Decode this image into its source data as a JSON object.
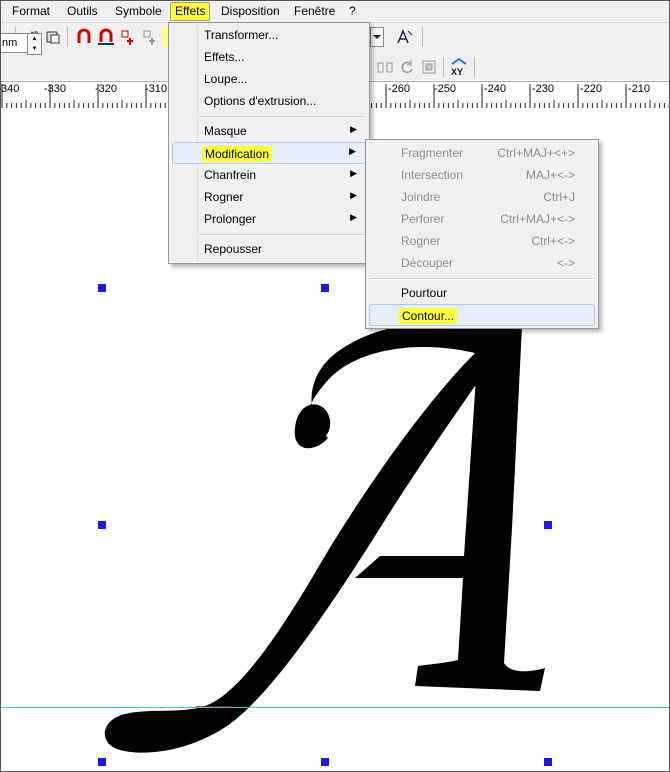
{
  "menubar": {
    "items": [
      {
        "label": "Format"
      },
      {
        "label": "Outils"
      },
      {
        "label": "Symbole"
      },
      {
        "label": "Effets"
      },
      {
        "label": "Disposition"
      },
      {
        "label": "Fenêtre"
      },
      {
        "label": "?"
      }
    ]
  },
  "toolbar": {
    "unit_value": "nm"
  },
  "ruler": {
    "labels": [
      "340",
      "-330",
      "-320",
      "-310",
      "-260",
      "-250",
      "-240",
      "-230",
      "-220",
      "-210"
    ]
  },
  "effets_menu": {
    "items": [
      {
        "label": "Transformer..."
      },
      {
        "label": "Effets..."
      },
      {
        "label": "Loupe..."
      },
      {
        "label": "Options d'extrusion..."
      },
      {
        "label": "Masque"
      },
      {
        "label": "Modification"
      },
      {
        "label": "Chanfrein"
      },
      {
        "label": "Rogner"
      },
      {
        "label": "Prolonger"
      },
      {
        "label": "Repousser"
      }
    ]
  },
  "modification_menu": {
    "items": [
      {
        "label": "Fragmenter",
        "shortcut": "Ctrl+MAJ+<+>"
      },
      {
        "label": "Intersection",
        "shortcut": "MAJ+<->"
      },
      {
        "label": "Joindre",
        "shortcut": "Ctrl+J"
      },
      {
        "label": "Perforer",
        "shortcut": "Ctrl+MAJ+<->"
      },
      {
        "label": "Rogner",
        "shortcut": "Ctrl+<->"
      },
      {
        "label": "Découper",
        "shortcut": "<->"
      },
      {
        "label": "Pourtour",
        "shortcut": ""
      },
      {
        "label": "Contour...",
        "shortcut": ""
      }
    ]
  },
  "canvas": {
    "glyph": "A"
  },
  "colors": {
    "highlight": "#ffff3a",
    "handle": "#1a1af0",
    "guide": "#33cccc"
  }
}
